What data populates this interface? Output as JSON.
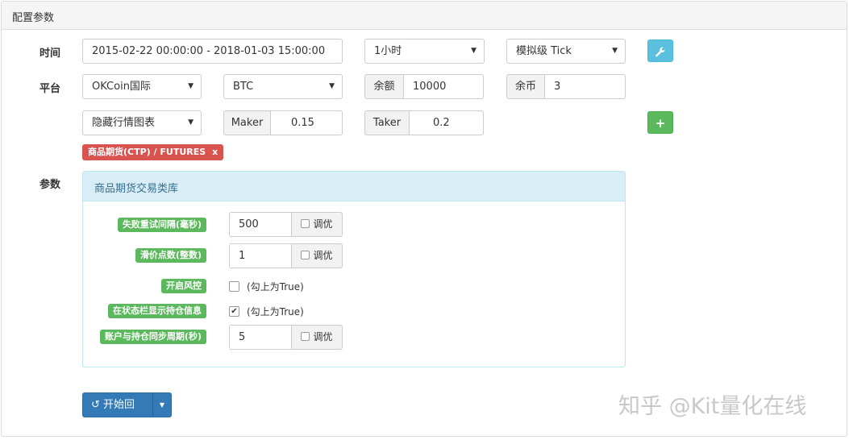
{
  "panel": {
    "title": "配置参数"
  },
  "rows": {
    "time_label": "时间",
    "platform_label": "平台",
    "params_label": "参数"
  },
  "time": {
    "range": "2015-02-22 00:00:00 - 2018-01-03 15:00:00",
    "period": "1小时",
    "mode": "模拟级 Tick"
  },
  "platform": {
    "exchange": "OKCoin国际",
    "currency": "BTC",
    "balance_label": "余额",
    "balance_value": "10000",
    "coins_label": "余币",
    "coins_value": "3",
    "chart_option": "隐藏行情图表",
    "maker_label": "Maker",
    "maker_value": "0.15",
    "taker_label": "Taker",
    "taker_value": "0.2"
  },
  "tag": {
    "label": "商品期货(CTP) / FUTURES",
    "remove": "x"
  },
  "params": {
    "library_title": "商品期货交易类库",
    "tune_label": "调优",
    "items": [
      {
        "label": "失败重试间隔(毫秒)",
        "value": "500"
      },
      {
        "label": "滑价点数(整数)",
        "value": "1"
      },
      {
        "label": "开启风控",
        "note": "(勾上为True)",
        "checked": false
      },
      {
        "label": "在状态栏显示持仓信息",
        "note": "(勾上为True)",
        "checked": true
      },
      {
        "label": "账户与持仓同步周期(秒)",
        "value": "5"
      }
    ]
  },
  "actions": {
    "run_label": "开始回测",
    "run_icon": "↺"
  },
  "icons": {
    "settings": "wrench-icon",
    "add": "plus-icon",
    "dropdown": "caret-down-icon"
  },
  "colors": {
    "info": "#5bc0de",
    "success": "#5cb85c",
    "danger": "#d9534f",
    "primary": "#337ab7",
    "panel_info_bg": "#d9edf7"
  },
  "watermark": "知乎 @Kit量化在线"
}
